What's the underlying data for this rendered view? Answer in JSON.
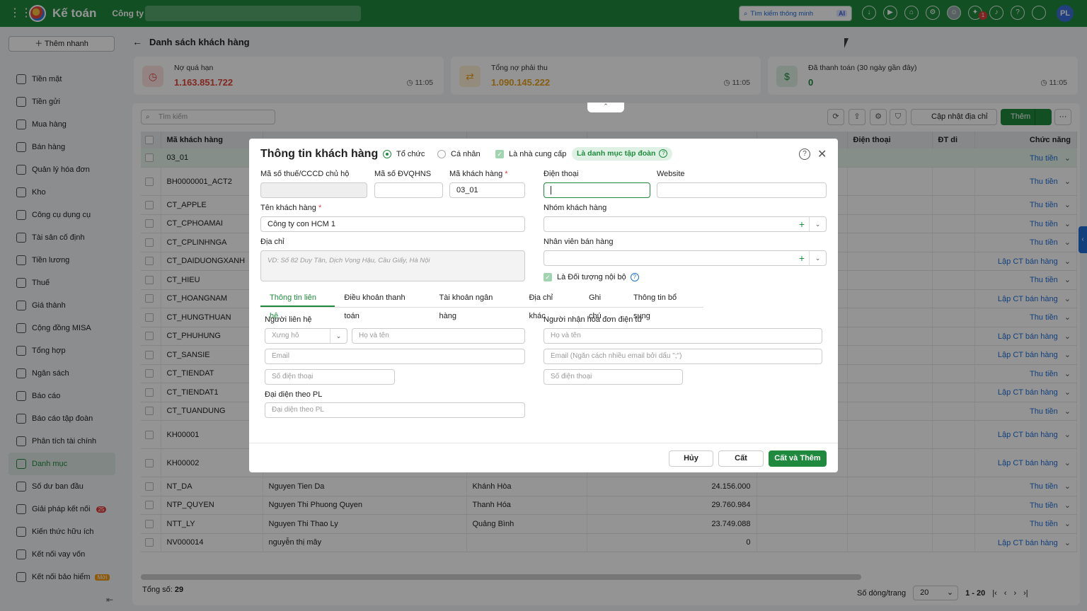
{
  "app": {
    "name": "Kế toán",
    "company": "Công ty",
    "user_initials": "PL",
    "notif_count": "1"
  },
  "search": {
    "placeholder": "Tìm kiếm thông minh",
    "ai_label": "AI"
  },
  "sidebar": {
    "quick_add": "Thêm nhanh",
    "items": [
      {
        "label": "Tiền mặt",
        "icon": "cash-icon"
      },
      {
        "label": "Tiền gửi",
        "icon": "bank-icon"
      },
      {
        "label": "Mua hàng",
        "icon": "bag-icon"
      },
      {
        "label": "Bán hàng",
        "icon": "cart-icon"
      },
      {
        "label": "Quản lý hóa đơn",
        "icon": "invoice-icon"
      },
      {
        "label": "Kho",
        "icon": "database-icon"
      },
      {
        "label": "Công cụ dụng cụ",
        "icon": "tools-icon"
      },
      {
        "label": "Tài sản cố định",
        "icon": "car-icon"
      },
      {
        "label": "Tiền lương",
        "icon": "salary-icon"
      },
      {
        "label": "Thuế",
        "icon": "tax-icon"
      },
      {
        "label": "Giá thành",
        "icon": "tag-icon"
      },
      {
        "label": "Cộng đồng MISA",
        "icon": "community-icon"
      },
      {
        "label": "Tổng hợp",
        "icon": "summary-icon"
      },
      {
        "label": "Ngân sách",
        "icon": "budget-icon"
      },
      {
        "label": "Báo cáo",
        "icon": "report-icon"
      },
      {
        "label": "Báo cáo tập đoàn",
        "icon": "group-report-icon"
      },
      {
        "label": "Phân tích tài chính",
        "icon": "analytics-icon"
      },
      {
        "label": "Danh mục",
        "icon": "list-icon"
      },
      {
        "label": "Số dư ban đầu",
        "icon": "balance-icon"
      },
      {
        "label": "Giải pháp kết nối",
        "icon": "connect-icon",
        "badge": "25"
      },
      {
        "label": "Kiến thức hữu ích",
        "icon": "bulb-icon"
      },
      {
        "label": "Kết nối vay vốn",
        "icon": "loan-icon"
      },
      {
        "label": "Kết nối bảo hiểm",
        "icon": "insurance-icon",
        "tag": "Mới"
      }
    ]
  },
  "page": {
    "title": "Danh sách khách hàng"
  },
  "stats": [
    {
      "label": "Nợ quá hạn",
      "value": "1.163.851.722",
      "time": "11:05",
      "color": "#e0453a"
    },
    {
      "label": "Tổng nợ phải thu",
      "value": "1.090.145.222",
      "time": "11:05",
      "color": "#e6a21a"
    },
    {
      "label": "Đã thanh toán (30 ngày gần đây)",
      "value": "0",
      "time": "11:05",
      "color": "#1f8a3d"
    }
  ],
  "toolbar": {
    "search_placeholder": "Tìm kiếm",
    "update_address": "Cập nhật địa chỉ",
    "add": "Thêm"
  },
  "table": {
    "headers": {
      "code": "Mã khách hàng",
      "phone": "Điện thoại",
      "mobile": "ĐT di",
      "actions": "Chức năng"
    },
    "rows": [
      {
        "code": "03_01",
        "name": "",
        "addr": "",
        "debt": "",
        "action": "Thu tiền"
      },
      {
        "code": "BH0000001_ACT2",
        "name": "",
        "addr": "",
        "debt": "",
        "action": "Thu tiền"
      },
      {
        "code": "CT_APPLE",
        "name": "",
        "addr": "",
        "debt": "",
        "action": "Thu tiền"
      },
      {
        "code": "CT_CPHOAMAI",
        "name": "",
        "addr": "",
        "debt": "",
        "action": "Thu tiền"
      },
      {
        "code": "CT_CPLINHNGA",
        "name": "",
        "addr": "",
        "debt": "",
        "action": "Thu tiền"
      },
      {
        "code": "CT_DAIDUONGXANH",
        "name": "",
        "addr": "",
        "debt": "",
        "action": "Lập CT bán hàng"
      },
      {
        "code": "CT_HIEU",
        "name": "",
        "addr": "",
        "debt": "",
        "action": "Thu tiền"
      },
      {
        "code": "CT_HOANGNAM",
        "name": "",
        "addr": "",
        "debt": "",
        "action": "Lập CT bán hàng"
      },
      {
        "code": "CT_HUNGTHUAN",
        "name": "",
        "addr": "",
        "debt": "",
        "action": "Thu tiền"
      },
      {
        "code": "CT_PHUHUNG",
        "name": "",
        "addr": "",
        "debt": "",
        "action": "Lập CT bán hàng"
      },
      {
        "code": "CT_SANSIE",
        "name": "",
        "addr": "",
        "debt": "",
        "action": "Lập CT bán hàng"
      },
      {
        "code": "CT_TIENDAT",
        "name": "",
        "addr": "",
        "debt": "",
        "action": "Thu tiền"
      },
      {
        "code": "CT_TIENDAT1",
        "name": "",
        "addr": "",
        "debt": "",
        "action": "Lập CT bán hàng"
      },
      {
        "code": "CT_TUANDUNG",
        "name": "",
        "addr": "",
        "debt": "",
        "action": "Thu tiền"
      },
      {
        "code": "KH00001",
        "name": "",
        "addr": "",
        "debt": "",
        "action": "Lập CT bán hàng"
      },
      {
        "code": "KH00002",
        "name": "",
        "addr": "",
        "debt": "",
        "action": "Lập CT bán hàng"
      },
      {
        "code": "NT_DA",
        "name": "Nguyen Tien Da",
        "addr": "Khánh Hòa",
        "debt": "24.156.000",
        "action": "Thu tiền"
      },
      {
        "code": "NTP_QUYEN",
        "name": "Nguyen Thi Phuong Quyen",
        "addr": "Thanh Hóa",
        "debt": "29.760.984",
        "action": "Thu tiền"
      },
      {
        "code": "NTT_LY",
        "name": "Nguyen Thi Thao Ly",
        "addr": "Quảng Bình",
        "debt": "23.749.088",
        "action": "Thu tiền"
      },
      {
        "code": "NV000014",
        "name": "nguyễn thị mây",
        "addr": "",
        "debt": "0",
        "action": "Lập CT bán hàng"
      }
    ],
    "total_label": "Tổng số:",
    "total": "29",
    "page_size_label": "Số dòng/trang",
    "page_size": "20",
    "range": "1 - 20"
  },
  "modal": {
    "title": "Thông tin khách hàng",
    "type_org": "Tổ chức",
    "type_person": "Cá nhân",
    "supplier": "Là nhà cung cấp",
    "group_pill": "Là danh mục tập đoàn",
    "tax_code": "Mã số thuế/CCCD chủ hộ",
    "budget_code": "Mã số ĐVQHNS",
    "customer_code": "Mã khách hàng",
    "customer_code_value": "03_01",
    "phone": "Điện thoại",
    "website": "Website",
    "customer_name": "Tên khách hàng",
    "customer_name_value": "Công ty con HCM 1",
    "customer_group": "Nhóm khách hàng",
    "address": "Địa chỉ",
    "address_placeholder": "VD: Số 82 Duy Tân, Dịch Vọng Hậu, Cầu Giấy, Hà Nội",
    "sales_staff": "Nhân viên bán hàng",
    "internal": "Là Đối tượng nội bộ",
    "tabs": [
      "Thông tin liên hệ",
      "Điều khoản thanh toán",
      "Tài khoản ngân hàng",
      "Địa chỉ khác",
      "Ghi chú",
      "Thông tin bổ sung"
    ],
    "contact_section": "Người liên hệ",
    "salutation_placeholder": "Xưng hô",
    "fullname_placeholder": "Họ và tên",
    "email_placeholder": "Email",
    "phone_placeholder": "Số điện thoại",
    "legal_rep": "Đại diện theo PL",
    "legal_rep_placeholder": "Đại diện theo PL",
    "einvoice_section": "Người nhận hóa đơn điện tử",
    "einvoice_name_placeholder": "Họ và tên",
    "einvoice_email_placeholder": "Email (Ngăn cách nhiều email bởi dấu \";\")",
    "einvoice_phone_placeholder": "Số điện thoại",
    "cancel": "Hủy",
    "save": "Cất",
    "save_add": "Cất và Thêm"
  }
}
